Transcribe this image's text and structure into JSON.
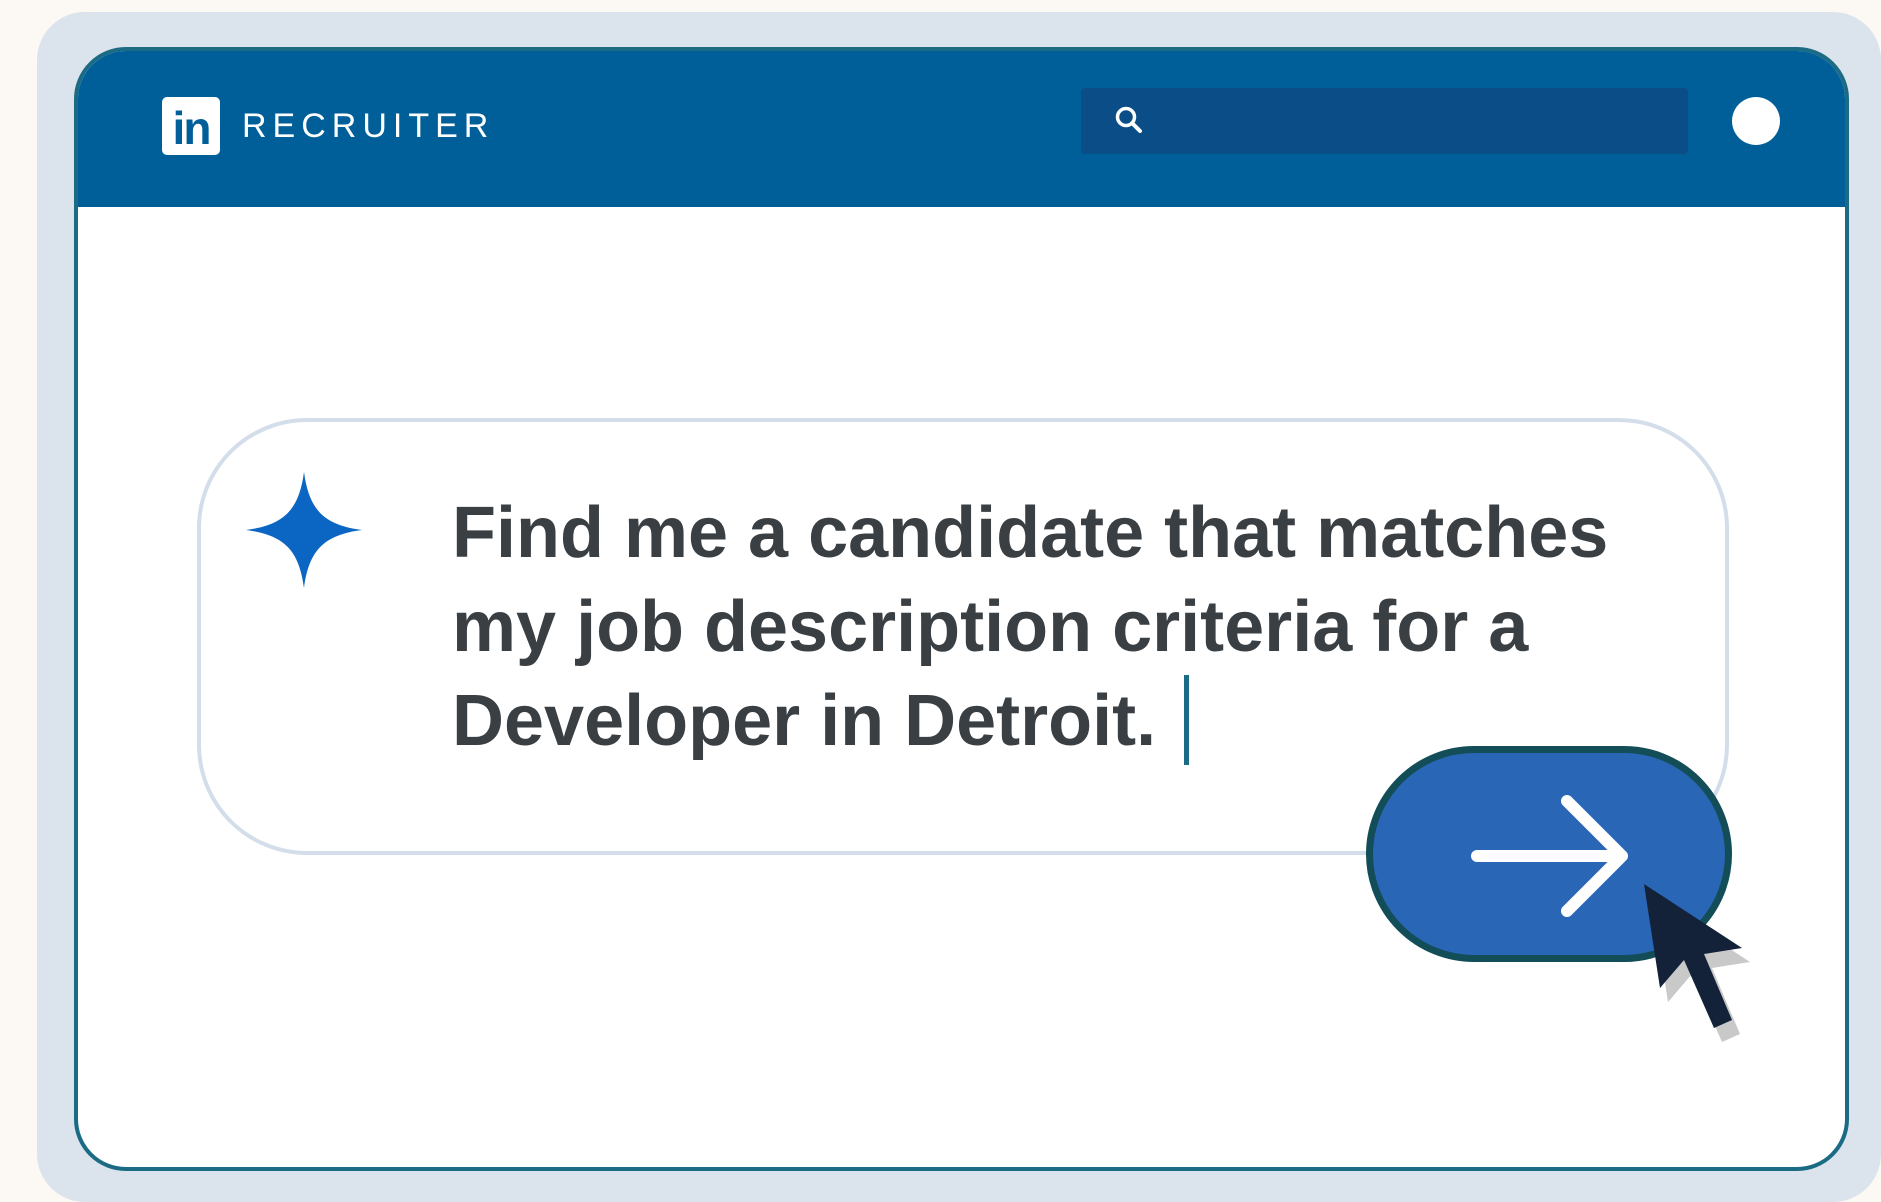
{
  "header": {
    "logo_text": "in",
    "brand": "RECRUITER",
    "search_icon": "search-icon",
    "avatar_icon": "avatar-circle"
  },
  "prompt": {
    "spark_icon": "sparkle-icon",
    "line1": "Find me a candidate that matches",
    "line2": "my job description criteria for a",
    "line3": "Developer in Detroit."
  },
  "send_button": {
    "icon": "arrow-right-icon"
  },
  "pointer": {
    "icon": "mouse-cursor-icon"
  },
  "colors": {
    "header_bg": "#005f99",
    "search_bg": "#0b4d86",
    "button_bg": "#2a66b6",
    "button_border": "#124d58",
    "spark": "#0a66c2",
    "text": "#3a3f44"
  }
}
